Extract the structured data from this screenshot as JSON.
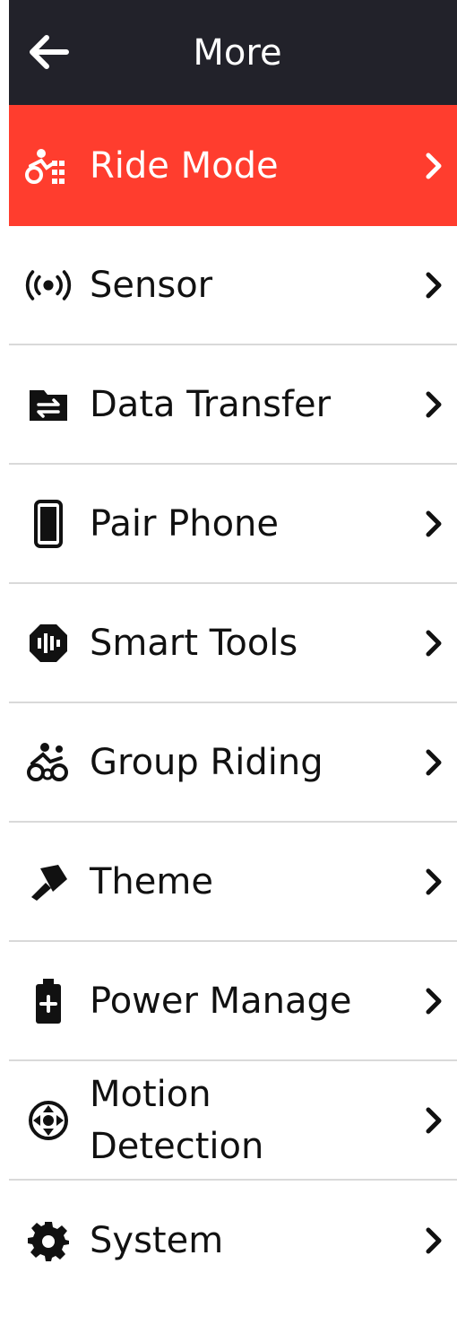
{
  "header": {
    "title": "More",
    "back_icon": "arrow-left-icon"
  },
  "colors": {
    "header_bg": "#22222a",
    "active_bg": "#ff3d2e",
    "text": "#111111",
    "divider": "#d9d9d9"
  },
  "menu": {
    "items": [
      {
        "label": "Ride Mode",
        "icon": "ride-mode-icon",
        "active": true
      },
      {
        "label": "Sensor",
        "icon": "sensor-icon",
        "active": false
      },
      {
        "label": "Data Transfer",
        "icon": "data-transfer-icon",
        "active": false
      },
      {
        "label": "Pair Phone",
        "icon": "phone-icon",
        "active": false
      },
      {
        "label": "Smart Tools",
        "icon": "smart-tools-icon",
        "active": false
      },
      {
        "label": "Group Riding",
        "icon": "group-riding-icon",
        "active": false
      },
      {
        "label": "Theme",
        "icon": "paint-brush-icon",
        "active": false
      },
      {
        "label": "Power Manage",
        "icon": "battery-plus-icon",
        "active": false
      },
      {
        "label": "Motion Detection",
        "icon": "motion-detection-icon",
        "active": false
      },
      {
        "label": "System",
        "icon": "gear-icon",
        "active": false
      }
    ]
  }
}
